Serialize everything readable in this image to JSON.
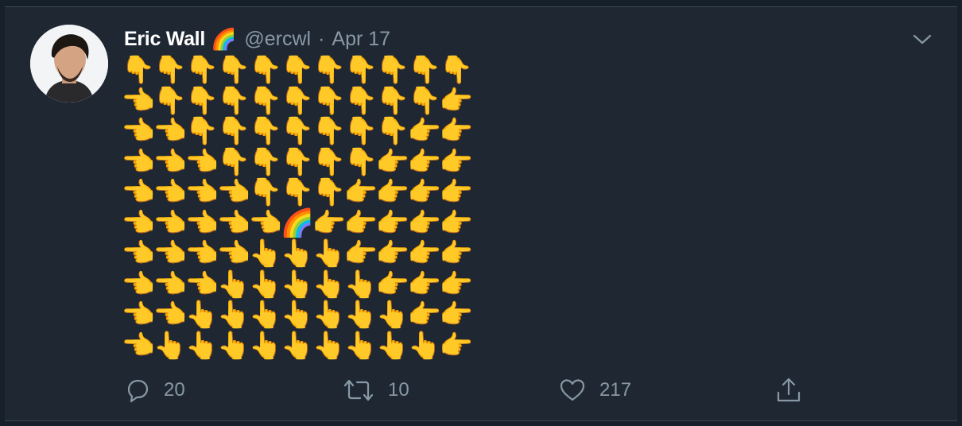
{
  "tweet": {
    "author_name": "Eric Wall",
    "author_emoji": "🌈",
    "handle": "@ercwl",
    "separator": "·",
    "date": "Apr 17"
  },
  "emoji_grid": {
    "rows": [
      [
        "👇",
        "👇",
        "👇",
        "👇",
        "👇",
        "👇",
        "👇",
        "👇",
        "👇",
        "👇",
        "👇"
      ],
      [
        "👈",
        "👇",
        "👇",
        "👇",
        "👇",
        "👇",
        "👇",
        "👇",
        "👇",
        "👇",
        "👉"
      ],
      [
        "👈",
        "👈",
        "👇",
        "👇",
        "👇",
        "👇",
        "👇",
        "👇",
        "👇",
        "👉",
        "👉"
      ],
      [
        "👈",
        "👈",
        "👈",
        "👇",
        "👇",
        "👇",
        "👇",
        "👇",
        "👉",
        "👉",
        "👉"
      ],
      [
        "👈",
        "👈",
        "👈",
        "👈",
        "👇",
        "👇",
        "👇",
        "👉",
        "👉",
        "👉",
        "👉"
      ],
      [
        "👈",
        "👈",
        "👈",
        "👈",
        "👈",
        "🌈",
        "👉",
        "👉",
        "👉",
        "👉",
        "👉"
      ],
      [
        "👈",
        "👈",
        "👈",
        "👈",
        "👆",
        "👆",
        "👆",
        "👉",
        "👉",
        "👉",
        "👉"
      ],
      [
        "👈",
        "👈",
        "👈",
        "👆",
        "👆",
        "👆",
        "👆",
        "👆",
        "👉",
        "👉",
        "👉"
      ],
      [
        "👈",
        "👈",
        "👆",
        "👆",
        "👆",
        "👆",
        "👆",
        "👆",
        "👆",
        "👉",
        "👉"
      ],
      [
        "👈",
        "👆",
        "👆",
        "👆",
        "👆",
        "👆",
        "👆",
        "👆",
        "👆",
        "👆",
        "👉"
      ]
    ],
    "skin_tones": [
      "#6b4632",
      "#8a5c3e",
      "#a87a55",
      "#c59a74",
      "#e3c08f",
      "#f2dcd2"
    ]
  },
  "actions": {
    "reply_count": "20",
    "retweet_count": "10",
    "like_count": "217"
  },
  "colors": {
    "background": "#15202b",
    "card": "#1f2733",
    "text_primary": "#ffffff",
    "text_secondary": "#8899a6"
  },
  "icons": {
    "menu": "chevron-down-icon",
    "reply": "reply-icon",
    "retweet": "retweet-icon",
    "like": "heart-icon",
    "share": "share-icon"
  }
}
